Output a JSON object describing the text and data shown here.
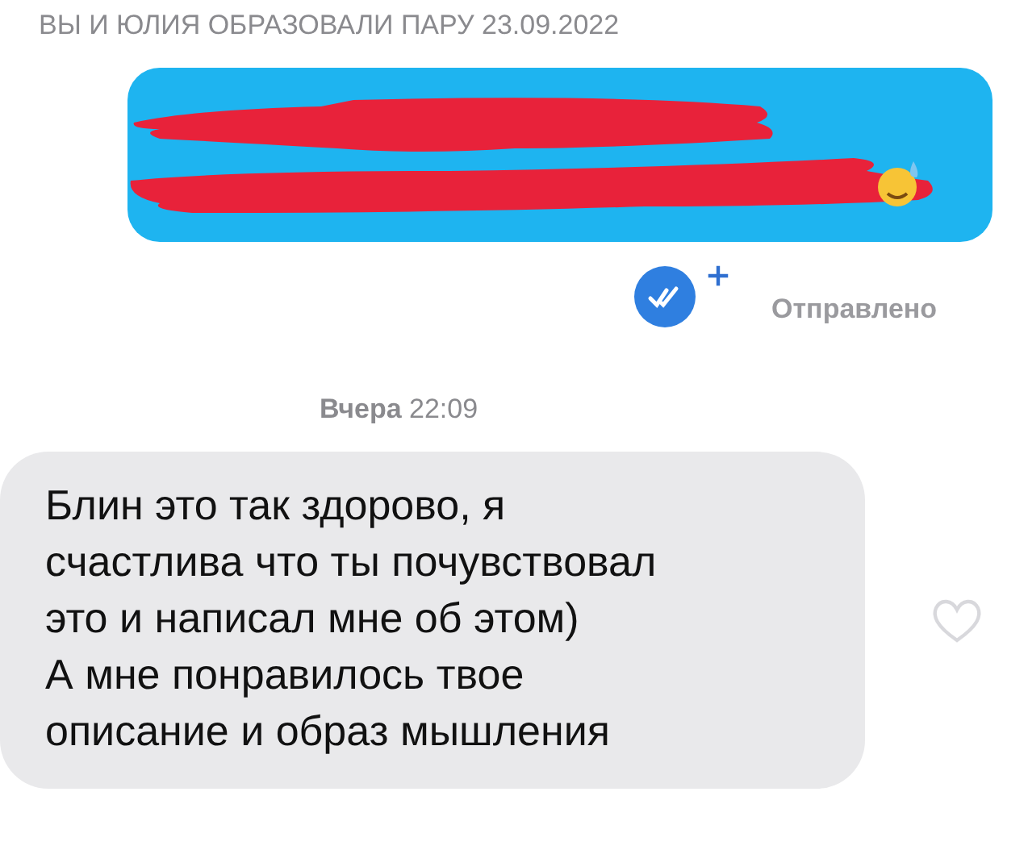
{
  "match_notice": "ВЫ И ЮЛИЯ ОБРАЗОВАЛИ ПАРУ 23.09.2022",
  "outgoing": {
    "status": "Отправлено",
    "read": true
  },
  "timestamp": "**Вчера** 22:09",
  "incoming": {
    "text": "Блин это так здорово, я\nсчастлива что ты почувствовал\nэто и написал мне об этом)\nА мне понравилось твое\nописание и образ мышления",
    "liked": false
  }
}
